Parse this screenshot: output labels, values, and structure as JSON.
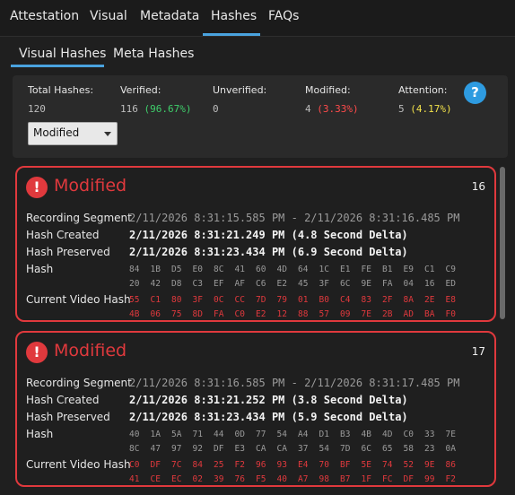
{
  "top_tabs": [
    {
      "label": "Attestation"
    },
    {
      "label": "Visual"
    },
    {
      "label": "Metadata"
    },
    {
      "label": "Hashes"
    },
    {
      "label": "FAQs"
    }
  ],
  "sub_tabs": [
    {
      "label": "Visual Hashes"
    },
    {
      "label": "Meta Hashes"
    }
  ],
  "summary": {
    "total": {
      "label": "Total Hashes:",
      "value": "120"
    },
    "verified": {
      "label": "Verified:",
      "value": "116",
      "pct": "(96.67%)"
    },
    "unverified": {
      "label": "Unverified:",
      "value": "0"
    },
    "modified": {
      "label": "Modified:",
      "value": "4",
      "pct": "(3.33%)"
    },
    "attention": {
      "label": "Attention:",
      "value": "5",
      "pct": "(4.17%)"
    },
    "help_label": "?",
    "filter": {
      "selected": "Modified"
    }
  },
  "labels": {
    "recording_segment": "Recording Segment",
    "hash_created": "Hash Created",
    "hash_preserved": "Hash Preserved",
    "hash": "Hash",
    "current_video_hash": "Current Video Hash"
  },
  "cards": [
    {
      "icon": "!",
      "status": "Modified",
      "number": "16",
      "recording_segment": "2/11/2026 8:31:15.585 PM - 2/11/2026 8:31:16.485 PM",
      "hash_created": "2/11/2026 8:31:21.249 PM (4.8 Second Delta)",
      "hash_preserved": "2/11/2026 8:31:23.434 PM (6.9 Second Delta)",
      "hash_rows": [
        [
          "84",
          "1B",
          "D5",
          "E0",
          "8C",
          "41",
          "60",
          "4D",
          "64",
          "1C",
          "E1",
          "FE",
          "B1",
          "E9",
          "C1",
          "C9"
        ],
        [
          "20",
          "42",
          "D8",
          "C3",
          "EF",
          "AF",
          "C6",
          "E2",
          "45",
          "3F",
          "6C",
          "9E",
          "FA",
          "04",
          "16",
          "ED"
        ]
      ],
      "current_rows": [
        [
          "55",
          "C1",
          "80",
          "3F",
          "0C",
          "CC",
          "7D",
          "79",
          "01",
          "B0",
          "C4",
          "83",
          "2F",
          "8A",
          "2E",
          "E8"
        ],
        [
          "4B",
          "06",
          "75",
          "8D",
          "FA",
          "C0",
          "E2",
          "12",
          "88",
          "57",
          "09",
          "7E",
          "2B",
          "AD",
          "BA",
          "F0"
        ]
      ]
    },
    {
      "icon": "!",
      "status": "Modified",
      "number": "17",
      "recording_segment": "2/11/2026 8:31:16.585 PM - 2/11/2026 8:31:17.485 PM",
      "hash_created": "2/11/2026 8:31:21.252 PM (3.8 Second Delta)",
      "hash_preserved": "2/11/2026 8:31:23.434 PM (5.9 Second Delta)",
      "hash_rows": [
        [
          "40",
          "1A",
          "5A",
          "71",
          "44",
          "0D",
          "77",
          "54",
          "A4",
          "D1",
          "B3",
          "4B",
          "4D",
          "C0",
          "33",
          "7E"
        ],
        [
          "8C",
          "47",
          "97",
          "92",
          "DF",
          "E3",
          "CA",
          "CA",
          "37",
          "54",
          "7D",
          "6C",
          "65",
          "58",
          "23",
          "0A"
        ]
      ],
      "current_rows": [
        [
          "C0",
          "DF",
          "7C",
          "84",
          "25",
          "F2",
          "96",
          "93",
          "E4",
          "70",
          "BF",
          "5E",
          "74",
          "52",
          "9E",
          "86"
        ],
        [
          "41",
          "CE",
          "EC",
          "02",
          "39",
          "76",
          "F5",
          "40",
          "A7",
          "98",
          "B7",
          "1F",
          "FC",
          "DF",
          "99",
          "F2"
        ]
      ]
    }
  ]
}
